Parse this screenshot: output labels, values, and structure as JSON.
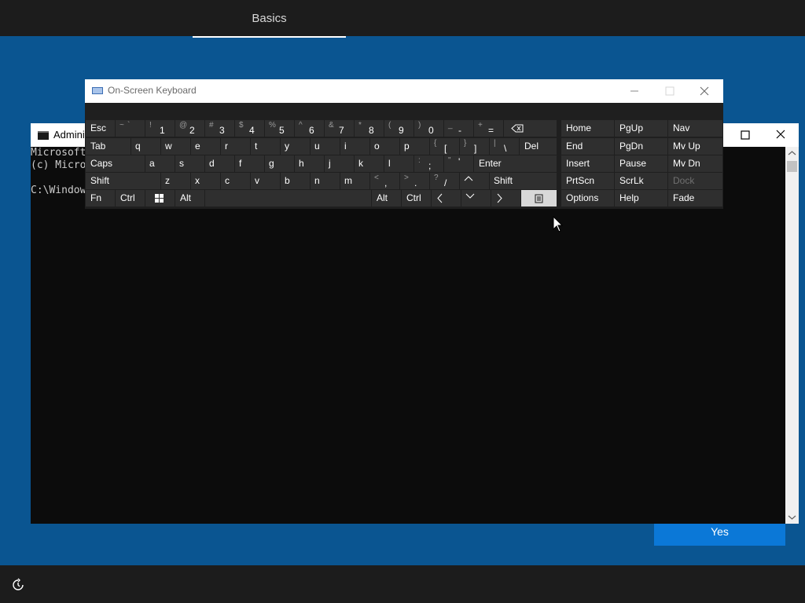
{
  "oobe": {
    "tab": "Basics",
    "yes_label": "Yes"
  },
  "cmd": {
    "title": "Admini",
    "lines": [
      "Microsoft",
      "(c) Micro",
      "",
      "C:\\Window"
    ]
  },
  "osk": {
    "title": "On-Screen Keyboard",
    "keys": {
      "esc": "Esc",
      "backtick_shift": "~",
      "backtick": "`",
      "k1_shift": "!",
      "k1": "1",
      "k2_shift": "@",
      "k2": "2",
      "k3_shift": "#",
      "k3": "3",
      "k4_shift": "$",
      "k4": "4",
      "k5_shift": "%",
      "k5": "5",
      "k6_shift": "^",
      "k6": "6",
      "k7_shift": "&",
      "k7": "7",
      "k8_shift": "*",
      "k8": "8",
      "k9_shift": "(",
      "k9": "9",
      "k0_shift": ")",
      "k0": "0",
      "minus_shift": "_",
      "minus": "-",
      "equal_shift": "+",
      "equal": "=",
      "tab": "Tab",
      "q": "q",
      "w": "w",
      "e": "e",
      "r": "r",
      "t": "t",
      "y": "y",
      "u": "u",
      "i": "i",
      "o": "o",
      "p": "p",
      "lbracket_shift": "{",
      "lbracket": "[",
      "rbracket_shift": "}",
      "rbracket": "]",
      "backslash_shift": "|",
      "backslash": "\\",
      "del": "Del",
      "caps": "Caps",
      "a": "a",
      "s": "s",
      "d": "d",
      "f": "f",
      "g": "g",
      "h": "h",
      "j": "j",
      "k": "k",
      "l": "l",
      "semicolon_shift": ":",
      "semicolon": ";",
      "quote_shift": "\"",
      "quote": "'",
      "enter": "Enter",
      "shift_left": "Shift",
      "z": "z",
      "x": "x",
      "c": "c",
      "v": "v",
      "b": "b",
      "n": "n",
      "m": "m",
      "comma_shift": "<",
      "comma": ",",
      "period_shift": ">",
      "period": ".",
      "slash_shift": "?",
      "slash": "/",
      "shift_right": "Shift",
      "fn": "Fn",
      "ctrl_left": "Ctrl",
      "alt_left": "Alt",
      "alt_right": "Alt",
      "ctrl_right": "Ctrl"
    },
    "nav": {
      "home": "Home",
      "pgup": "PgUp",
      "nav": "Nav",
      "end": "End",
      "pgdn": "PgDn",
      "mvup": "Mv Up",
      "insert": "Insert",
      "pause": "Pause",
      "mvdn": "Mv Dn",
      "prtscn": "PrtScn",
      "scrlk": "ScrLk",
      "dock": "Dock",
      "options": "Options",
      "help": "Help",
      "fade": "Fade"
    }
  },
  "colors": {
    "desktop_blue": "#0a5591",
    "accent_button": "#0b78d7",
    "key_face": "#2f2f2f",
    "key_pressed": "#d8d8d8"
  }
}
